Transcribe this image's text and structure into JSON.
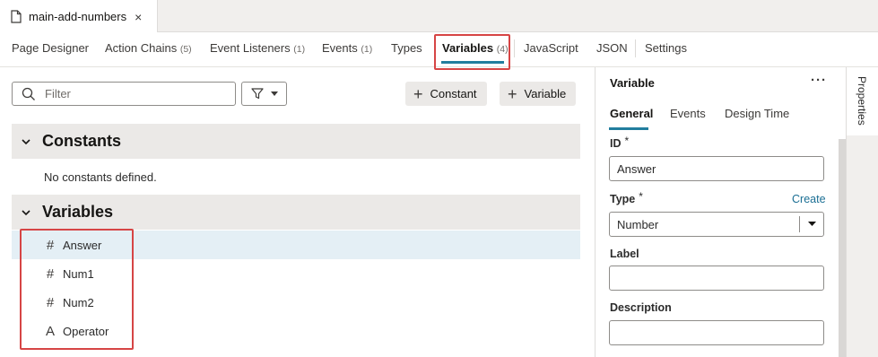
{
  "file_tab": {
    "name": "main-add-numbers",
    "close_glyph": "×"
  },
  "nav_tabs": [
    {
      "label": "Page Designer",
      "count": ""
    },
    {
      "label": "Action Chains",
      "count": "(5)"
    },
    {
      "label": "Event Listeners",
      "count": "(1)"
    },
    {
      "label": "Events",
      "count": "(1)"
    },
    {
      "label": "Types",
      "count": ""
    },
    {
      "label": "Variables",
      "count": "(4)"
    },
    {
      "label": "JavaScript",
      "count": ""
    },
    {
      "label": "JSON",
      "count": ""
    },
    {
      "label": "Settings",
      "count": ""
    }
  ],
  "active_tab": "Variables",
  "toolbar": {
    "filter_placeholder": "Filter",
    "constant_button": "Constant",
    "variable_button": "Variable"
  },
  "constants": {
    "title": "Constants",
    "empty_message": "No constants defined."
  },
  "variables": {
    "title": "Variables",
    "items": [
      {
        "name": "Answer",
        "type_icon": "#",
        "icon_name": "number-icon",
        "selected": true
      },
      {
        "name": "Num1",
        "type_icon": "#",
        "icon_name": "number-icon",
        "selected": false
      },
      {
        "name": "Num2",
        "type_icon": "#",
        "icon_name": "number-icon",
        "selected": false
      },
      {
        "name": "Operator",
        "type_icon": "A",
        "icon_name": "string-icon",
        "selected": false
      }
    ]
  },
  "properties": {
    "title": "Variable",
    "more_glyph": "···",
    "tabs": [
      "General",
      "Events",
      "Design Time"
    ],
    "active_tab": "General",
    "id_label": "ID",
    "id_value": "Answer",
    "required_marker": "*",
    "type_label": "Type",
    "type_create_link": "Create",
    "type_value": "Number",
    "label_label": "Label",
    "label_value": "",
    "description_label": "Description",
    "description_value": ""
  },
  "side_rail": {
    "properties_tab": "Properties"
  },
  "colors": {
    "accent": "#227e9e",
    "highlight_box": "#d64545",
    "selected_row": "#e4eff5",
    "section_header": "#ebe9e7"
  }
}
